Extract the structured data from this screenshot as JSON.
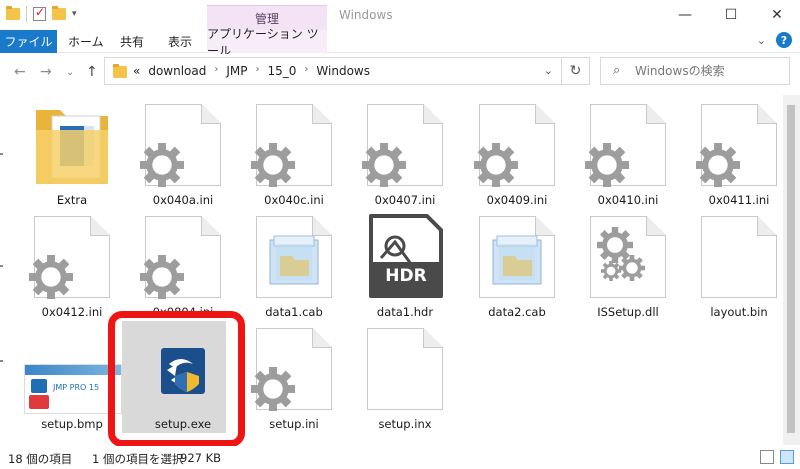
{
  "window": {
    "title": "Windows",
    "context_group": "管理",
    "controls": [
      "—",
      "☐",
      "✕"
    ]
  },
  "ribbon": {
    "file_tab": "ファイル",
    "tabs": [
      "ホーム",
      "共有",
      "表示"
    ],
    "context_tab": "アプリケーション ツール"
  },
  "address": {
    "crumbs": [
      "download",
      "JMP",
      "15_0",
      "Windows"
    ],
    "prefix": "«"
  },
  "search": {
    "placeholder": "Windowsの検索"
  },
  "files": [
    {
      "name": "Extra",
      "type": "folder"
    },
    {
      "name": "0x040a.ini",
      "type": "ini"
    },
    {
      "name": "0x040c.ini",
      "type": "ini"
    },
    {
      "name": "0x0407.ini",
      "type": "ini"
    },
    {
      "name": "0x0409.ini",
      "type": "ini"
    },
    {
      "name": "0x0410.ini",
      "type": "ini"
    },
    {
      "name": "0x0411.ini",
      "type": "ini"
    },
    {
      "name": "0x0412.ini",
      "type": "ini"
    },
    {
      "name": "0x0804.ini",
      "type": "ini"
    },
    {
      "name": "data1.cab",
      "type": "cab"
    },
    {
      "name": "data1.hdr",
      "type": "hdr",
      "badge": "HDR"
    },
    {
      "name": "data2.cab",
      "type": "cab"
    },
    {
      "name": "ISSetup.dll",
      "type": "dll"
    },
    {
      "name": "layout.bin",
      "type": "bin"
    },
    {
      "name": "setup.bmp",
      "type": "bmp",
      "thumb_text": "JMP PRO 15"
    },
    {
      "name": "setup.exe",
      "type": "exe",
      "selected": true
    },
    {
      "name": "setup.ini",
      "type": "ini"
    },
    {
      "name": "setup.inx",
      "type": "inx"
    }
  ],
  "status": {
    "count": "18 個の項目",
    "selection": "1 個の項目を選択",
    "size": "927 KB"
  },
  "colors": {
    "file_tab": "#1979ca",
    "context": "#f3e3f5",
    "highlight": "#f01515"
  }
}
